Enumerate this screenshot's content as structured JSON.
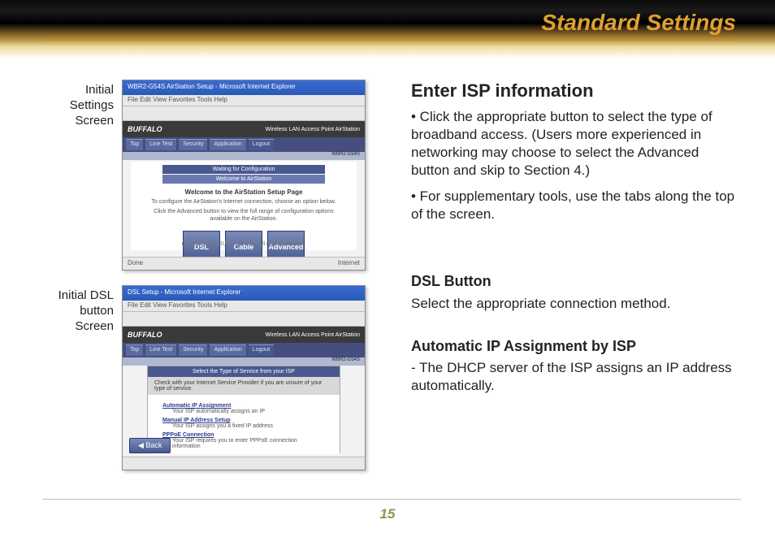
{
  "header": {
    "title": "Standard Settings"
  },
  "page_number": "15",
  "captions": {
    "first": "Initial Settings Screen",
    "second": "Initial DSL button Screen"
  },
  "screenshot1": {
    "window_title": "WBR2-G54S  AirStation Setup - Microsoft Internet Explorer",
    "menu": "File  Edit  View  Favorites  Tools  Help",
    "brand": "BUFFALO",
    "brand_sub": "Wireless LAN Access Point\nAirStation",
    "addr": "WBR2-G54S",
    "tabs": [
      "Top",
      "Line Test",
      "Security",
      "Application",
      "Logout"
    ],
    "wait": "Waiting for Configuration",
    "welcome_band": "Welcome to AirStation",
    "welcome": "Welcome to the AirStation Setup Page",
    "line1": "To configure the AirStation's Internet connection, choose an option below.",
    "line2": "Click the Advanced button to view the full range of configuration options available on the AirStation.",
    "buttons": {
      "dsl": "DSL",
      "cable": "Cable",
      "advanced": "Advanced"
    },
    "copyright": "(C)2000-2004 BUFFALO INC. All rights reserved.",
    "status_left": "Done",
    "status_right": "Internet"
  },
  "screenshot2": {
    "window_title": "DSL Setup - Microsoft Internet Explorer",
    "menu": "File  Edit  View  Favorites  Tools  Help",
    "brand": "BUFFALO",
    "brand_sub": "Wireless LAN Access Point\nAirStation",
    "addr": "WBR2-G54S",
    "tabs": [
      "Top",
      "Line Test",
      "Security",
      "Application",
      "Logout"
    ],
    "select_band": "Select the Type of Service from your ISP",
    "check_line": "Check with your Internet Service Provider if you are unsure of your type of service.",
    "opt1": "Automatic IP Assignment",
    "opt1_sub": "Your ISP automatically assigns an IP",
    "opt2": "Manual IP Address Setup",
    "opt2_sub": "Your ISP assigns you a fixed IP address",
    "opt3": "PPPoE Connection",
    "opt3_sub": "Your ISP requires you to enter PPPoE connection information",
    "back": "◀ Back"
  },
  "text": {
    "h1": "Enter ISP information",
    "p1": "• Click the appropriate button to select the type of broadband access.  (Users more experienced in networking may choose to select the Advanced button and skip to Section 4.)",
    "p2": "• For supplementary tools, use the tabs along the top of the screen.",
    "h2": "DSL Button",
    "p3": "Select the appropriate connection method.",
    "h3": "Automatic IP Assignment by ISP",
    "p4": "- The DHCP server of the ISP assigns an IP address automatically."
  }
}
